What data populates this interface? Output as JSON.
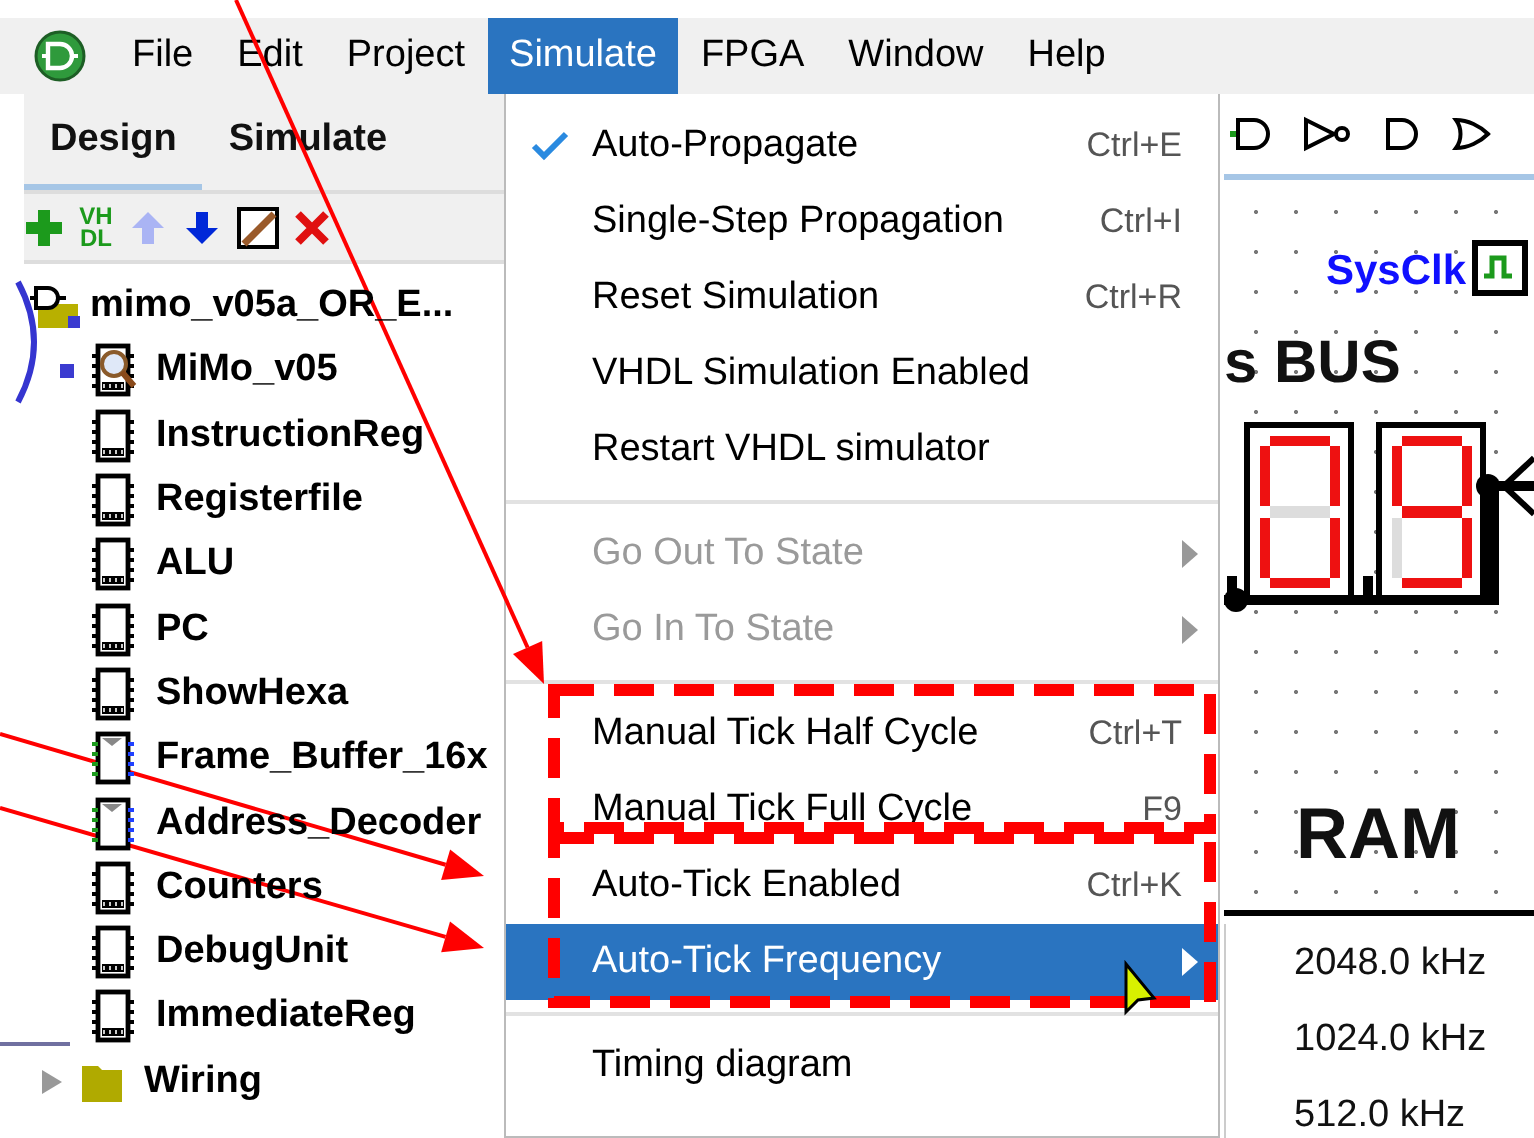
{
  "menubar": {
    "items": [
      {
        "label": "File",
        "selected": false
      },
      {
        "label": "Edit",
        "selected": false
      },
      {
        "label": "Project",
        "selected": false
      },
      {
        "label": "Simulate",
        "selected": true
      },
      {
        "label": "FPGA",
        "selected": false
      },
      {
        "label": "Window",
        "selected": false
      },
      {
        "label": "Help",
        "selected": false
      }
    ]
  },
  "panel": {
    "tabs": [
      {
        "label": "Design",
        "selected": true
      },
      {
        "label": "Simulate",
        "selected": false
      }
    ],
    "toolbar": [
      {
        "kind": "add",
        "disabled": false
      },
      {
        "kind": "vhdl",
        "label": "VHDL",
        "disabled": false
      },
      {
        "kind": "up",
        "disabled": true
      },
      {
        "kind": "down",
        "disabled": false
      },
      {
        "kind": "appearance",
        "disabled": false
      },
      {
        "kind": "delete",
        "disabled": false
      }
    ],
    "tree": [
      {
        "label": "mimo_v05a_OR_E...",
        "kind": "project",
        "expanded": true,
        "children": [
          {
            "label": "MiMo_v05",
            "kind": "circuit",
            "current": true
          },
          {
            "label": "InstructionReg",
            "kind": "circuit",
            "current": false
          },
          {
            "label": "Registerfile",
            "kind": "circuit",
            "current": false
          },
          {
            "label": "ALU",
            "kind": "circuit",
            "current": false
          },
          {
            "label": "PC",
            "kind": "circuit",
            "current": false
          },
          {
            "label": "ShowHexa",
            "kind": "circuit",
            "current": false
          },
          {
            "label": "Frame_Buffer_16x",
            "kind": "vhdl",
            "current": false
          },
          {
            "label": "Address_Decoder",
            "kind": "vhdl",
            "current": false
          },
          {
            "label": "Counters",
            "kind": "circuit",
            "current": false
          },
          {
            "label": "DebugUnit",
            "kind": "circuit",
            "current": false
          },
          {
            "label": "ImmediateReg",
            "kind": "circuit",
            "current": false
          }
        ]
      },
      {
        "label": "Wiring",
        "kind": "library",
        "expanded": false
      }
    ]
  },
  "simulate_menu": {
    "groups": [
      [
        {
          "label": "Auto-Propagate",
          "shortcut": "Ctrl+E",
          "checked": true,
          "disabled": false,
          "selected": false,
          "submenu": false
        },
        {
          "label": "Single-Step Propagation",
          "shortcut": "Ctrl+I",
          "checked": false,
          "disabled": false,
          "selected": false,
          "submenu": false
        },
        {
          "label": "Reset Simulation",
          "shortcut": "Ctrl+R",
          "checked": false,
          "disabled": false,
          "selected": false,
          "submenu": false
        },
        {
          "label": "VHDL Simulation Enabled",
          "checked": false,
          "disabled": false,
          "selected": false,
          "submenu": false
        },
        {
          "label": "Restart VHDL simulator",
          "checked": false,
          "disabled": false,
          "selected": false,
          "submenu": false
        }
      ],
      [
        {
          "label": "Go Out To State",
          "checked": false,
          "disabled": true,
          "selected": false,
          "submenu": true
        },
        {
          "label": "Go In To State",
          "checked": false,
          "disabled": true,
          "selected": false,
          "submenu": true
        }
      ],
      [
        {
          "label": "Manual Tick Half Cycle",
          "shortcut": "Ctrl+T",
          "checked": false,
          "disabled": false,
          "selected": false,
          "submenu": false
        },
        {
          "label": "Manual Tick Full Cycle",
          "shortcut": "F9",
          "checked": false,
          "disabled": false,
          "selected": false,
          "submenu": false
        },
        {
          "label": "Auto-Tick Enabled",
          "shortcut": "Ctrl+K",
          "checked": false,
          "disabled": false,
          "selected": false,
          "submenu": false
        },
        {
          "label": "Auto-Tick Frequency",
          "checked": false,
          "disabled": false,
          "selected": true,
          "submenu": true
        }
      ],
      [
        {
          "label": "Timing diagram",
          "checked": false,
          "disabled": false,
          "selected": false,
          "submenu": false
        }
      ]
    ]
  },
  "canvas": {
    "clock_label": "SysClk",
    "bus_label": "s BUS",
    "ram_label": "RAM",
    "displays": [
      {
        "segments": [
          true,
          true,
          true,
          true,
          true,
          true,
          false
        ]
      },
      {
        "segments": [
          true,
          true,
          true,
          true,
          false,
          true,
          true
        ]
      }
    ]
  },
  "frequency_submenu": {
    "items": [
      "2048.0 kHz",
      "1024.0 kHz",
      "512.0 kHz"
    ]
  }
}
